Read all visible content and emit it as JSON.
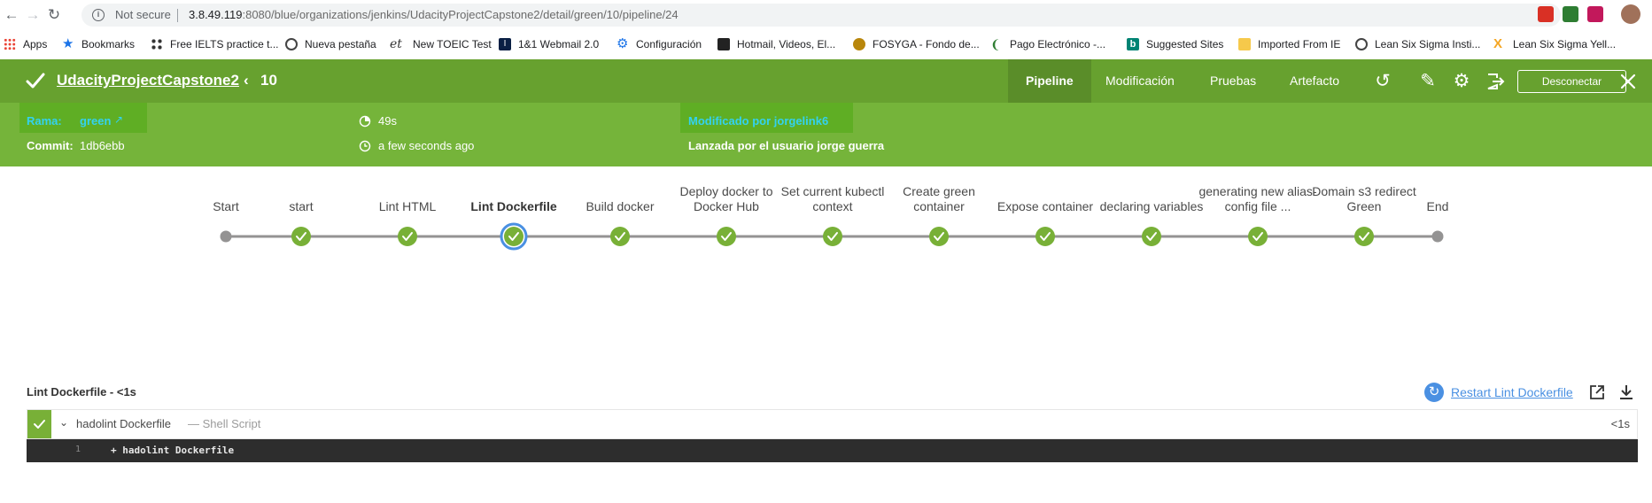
{
  "browser": {
    "security": "Not secure",
    "url_host": "3.8.49.119",
    "url_rest": ":8080/blue/organizations/jenkins/UdacityProjectCapstone2/detail/green/10/pipeline/24",
    "bookmarks": [
      {
        "label": "Apps"
      },
      {
        "label": "Bookmarks"
      },
      {
        "label": "Free IELTS practice t..."
      },
      {
        "label": "Nueva pestaña"
      },
      {
        "label": "New TOEIC Test"
      },
      {
        "label": "1&1 Webmail 2.0"
      },
      {
        "label": "Configuración"
      },
      {
        "label": "Hotmail, Videos, El..."
      },
      {
        "label": "FOSYGA - Fondo de..."
      },
      {
        "label": "Pago Electrónico -..."
      },
      {
        "label": "Suggested Sites"
      },
      {
        "label": "Imported From IE"
      },
      {
        "label": "Lean Six Sigma Insti..."
      },
      {
        "label": "Lean Six Sigma Yell..."
      }
    ]
  },
  "header": {
    "project": "UdacityProjectCapstone2",
    "run_number": "10",
    "tabs": [
      "Pipeline",
      "Modificación",
      "Pruebas",
      "Artefacto"
    ],
    "logout": "Desconectar"
  },
  "run": {
    "branch_label": "Rama:",
    "branch": "green",
    "commit_label": "Commit:",
    "commit": "1db6ebb",
    "duration": "49s",
    "started": "a few seconds ago",
    "changed_by": "Modificado por jorgelink6",
    "triggered_by": "Lanzada por el usuario jorge guerra"
  },
  "pipeline": {
    "stages": [
      {
        "label": "Start",
        "status": "start"
      },
      {
        "label": "start",
        "status": "success"
      },
      {
        "label": "Lint HTML",
        "status": "success"
      },
      {
        "label": "Lint Dockerfile",
        "status": "selected"
      },
      {
        "label": "Build docker",
        "status": "success"
      },
      {
        "label": "Deploy docker to Docker Hub",
        "status": "success"
      },
      {
        "label": "Set current kubectl context",
        "status": "success"
      },
      {
        "label": "Create green container",
        "status": "success"
      },
      {
        "label": "Expose container",
        "status": "success"
      },
      {
        "label": "declaring variables",
        "status": "success"
      },
      {
        "label": "generating new alias-config file ...",
        "status": "success"
      },
      {
        "label": "Domain s3 redirect Green",
        "status": "success"
      },
      {
        "label": "End",
        "status": "end"
      }
    ]
  },
  "log": {
    "title": "Lint Dockerfile - <1s",
    "restart": "Restart Lint Dockerfile",
    "step": {
      "name": "hadolint Dockerfile",
      "type": "— Shell Script",
      "duration": "<1s"
    },
    "lines": [
      {
        "n": "1",
        "text": "+ hadolint Dockerfile"
      }
    ]
  },
  "colors": {
    "header": "#67a12f",
    "info": "#75b43a",
    "success": "#78b037",
    "selected_ring": "#4a90e2",
    "link": "#4a90e2"
  }
}
